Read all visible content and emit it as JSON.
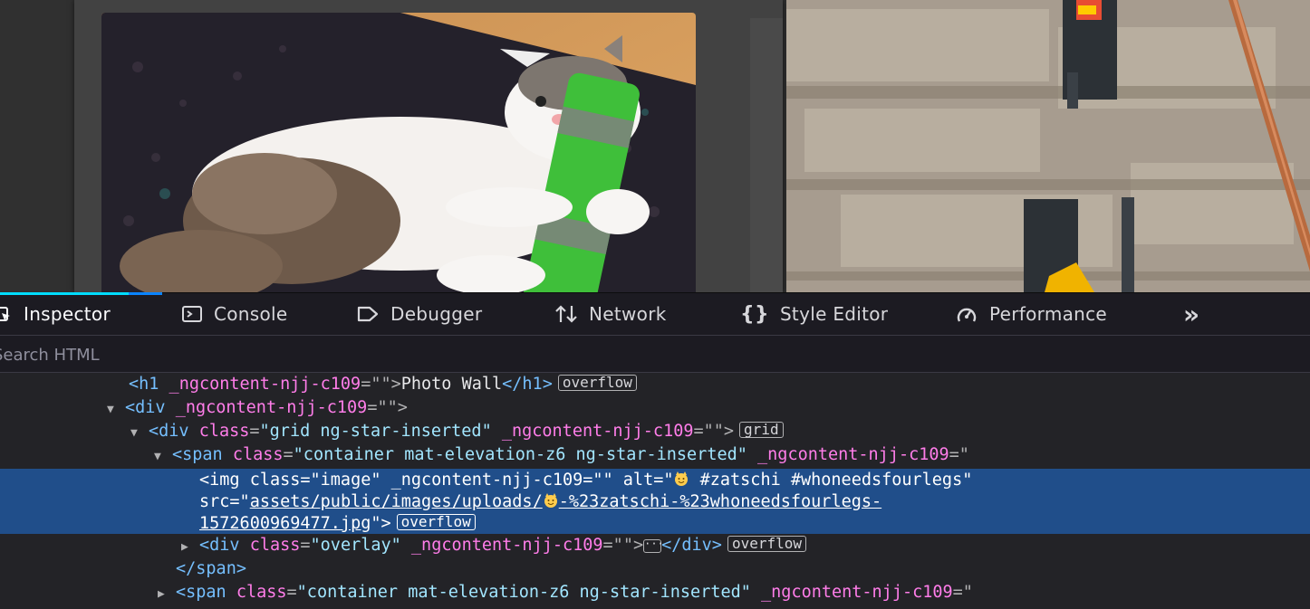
{
  "page": {
    "photos": [
      {
        "subject": "white and tabby cat hugging a green toy"
      },
      {
        "subject": "stone wall with metal brackets and copper pipe"
      }
    ]
  },
  "toolbar": {
    "tabs": [
      {
        "label": "Inspector",
        "icon": "inspector-icon",
        "active": true
      },
      {
        "label": "Console",
        "icon": "console-icon"
      },
      {
        "label": "Debugger",
        "icon": "debugger-icon"
      },
      {
        "label": "Network",
        "icon": "network-icon"
      },
      {
        "label": "Style Editor",
        "icon": "style-editor-icon"
      },
      {
        "label": "Performance",
        "icon": "performance-icon"
      }
    ],
    "more_label": "»"
  },
  "search": {
    "placeholder": "Search HTML"
  },
  "tree": {
    "h1": {
      "open": "<h1",
      "attr": " _ngcontent-njj-c109",
      "eq": "=\"\">",
      "text": "Photo Wall",
      "close": "</h1>",
      "badge": "overflow"
    },
    "div1": {
      "open": "<div",
      "attr": " _ngcontent-njj-c109",
      "eq": "=\"\">"
    },
    "div2": {
      "open": "<div",
      "attr_class": " class",
      "val_class": "\"grid ng-star-inserted\"",
      "attr": " _ngcontent-njj-c109",
      "eq": "=\"\">",
      "badge": "grid"
    },
    "span1": {
      "open": "<span",
      "attr_class": " class",
      "val_class": "\"container mat-elevation-z6 ng-star-inserted\"",
      "attr": " _ngcontent-njj-c109",
      "eq": "=\""
    },
    "img": {
      "line1_pre": "<img class=\"image\" _ngcontent-njj-c109=\"\" alt=\"",
      "line1_post": " #zatschi #whoneedsfourlegs\"",
      "line2_pre": "src=\"",
      "line2_link_a": "assets/public/images/uploads/",
      "line2_link_b": "-%23zatschi-%23whoneedsfourlegs-",
      "line3_link": "1572600969477.jpg",
      "line3_post": "\">",
      "badge": "overflow"
    },
    "overlay": {
      "open": "<div",
      "attr_class": " class",
      "val_class": "\"overlay\"",
      "attr": " _ngcontent-njj-c109",
      "eq": "=\"\">",
      "close": "</div>",
      "badge": "overflow"
    },
    "span_close": "</span>",
    "span2": {
      "open": "<span",
      "attr_class": " class",
      "val_class": "\"container mat-elevation-z6 ng-star-inserted\"",
      "attr": " _ngcontent-njj-c109",
      "eq": "=\""
    }
  },
  "colors": {
    "selection": "#204e8a",
    "tag": "#75bfff",
    "attr_name": "#ff7de9",
    "attr_value": "#a2e6ff",
    "active_tab_indicator": "#00ddff"
  }
}
